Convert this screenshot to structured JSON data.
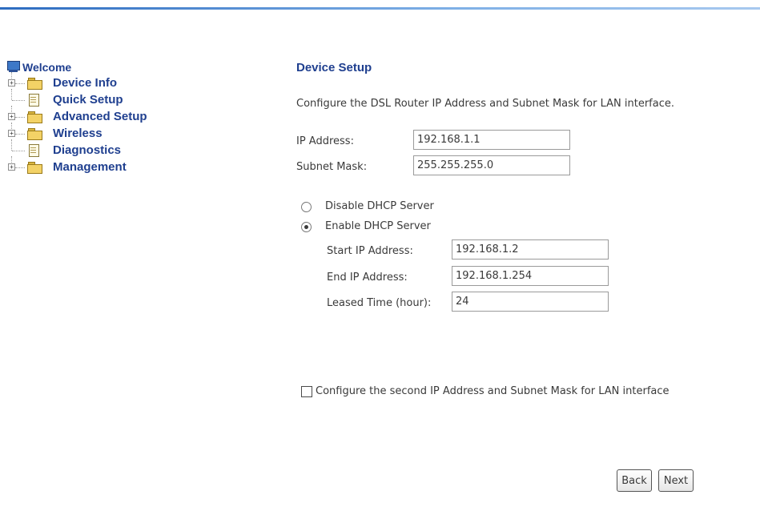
{
  "sidebar": {
    "root_label": "Welcome",
    "items": [
      {
        "label": "Device Info",
        "type": "folder",
        "expandable": true
      },
      {
        "label": "Quick Setup",
        "type": "page",
        "expandable": false
      },
      {
        "label": "Advanced Setup",
        "type": "folder",
        "expandable": true
      },
      {
        "label": "Wireless",
        "type": "folder",
        "expandable": true
      },
      {
        "label": "Diagnostics",
        "type": "page",
        "expandable": false
      },
      {
        "label": "Management",
        "type": "folder",
        "expandable": true
      }
    ]
  },
  "main": {
    "title": "Device Setup",
    "description": "Configure the DSL Router IP Address and Subnet Mask for LAN interface.",
    "ip_address": {
      "label": "IP Address:",
      "value": "192.168.1.1"
    },
    "subnet_mask": {
      "label": "Subnet Mask:",
      "value": "255.255.255.0"
    },
    "dhcp": {
      "disable_label": "Disable DHCP Server",
      "enable_label": "Enable DHCP Server",
      "selected": "enable",
      "start_ip": {
        "label": "Start IP Address:",
        "value": "192.168.1.2"
      },
      "end_ip": {
        "label": "End IP Address:",
        "value": "192.168.1.254"
      },
      "lease_time": {
        "label": "Leased Time (hour):",
        "value": "24"
      }
    },
    "second_ip_checkbox": {
      "label": "Configure the second IP Address and Subnet Mask for LAN interface",
      "checked": false
    },
    "buttons": {
      "back": "Back",
      "next": "Next"
    }
  }
}
